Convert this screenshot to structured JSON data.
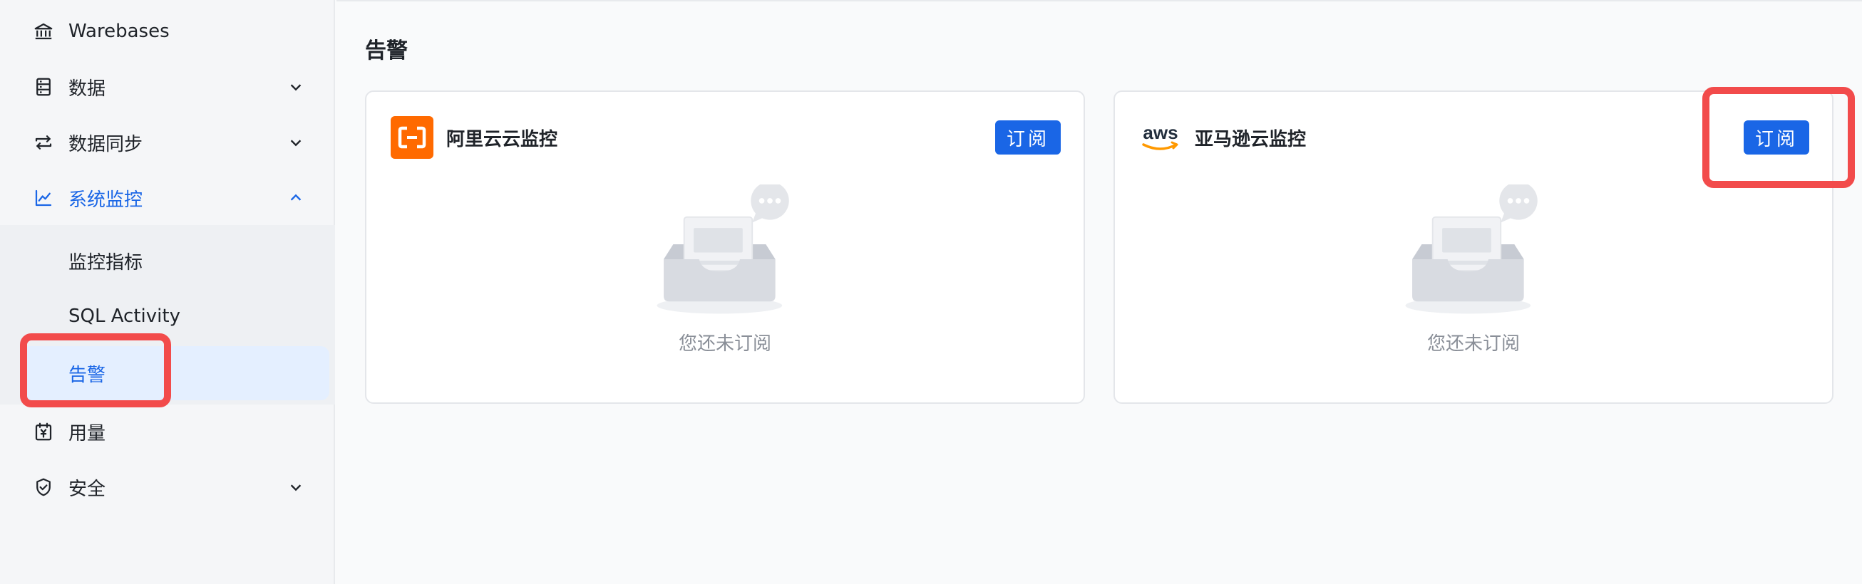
{
  "sidebar": {
    "items": [
      {
        "label": "Warebases",
        "icon": "bank-icon"
      },
      {
        "label": "数据",
        "icon": "database-icon"
      },
      {
        "label": "数据同步",
        "icon": "sync-icon"
      },
      {
        "label": "系统监控",
        "icon": "line-chart-icon"
      }
    ],
    "monitor_sub": [
      {
        "label": "监控指标"
      },
      {
        "label": "SQL Activity"
      },
      {
        "label": "告警"
      }
    ],
    "items_bottom": [
      {
        "label": "用量",
        "icon": "calendar-yen-icon"
      },
      {
        "label": "安全",
        "icon": "shield-check-icon"
      }
    ]
  },
  "main": {
    "title": "告警",
    "cards": [
      {
        "name": "阿里云云监控",
        "button": "订阅",
        "empty_text": "您还未订阅",
        "logo": "aliyun-logo"
      },
      {
        "name": "亚马逊云监控",
        "button": "订阅",
        "empty_text": "您还未订阅",
        "logo": "aws-logo",
        "logo_text": "aws"
      }
    ]
  },
  "colors": {
    "accent": "#1a66e6",
    "aliyun": "#ff6a00",
    "highlight": "#f24b4b"
  }
}
